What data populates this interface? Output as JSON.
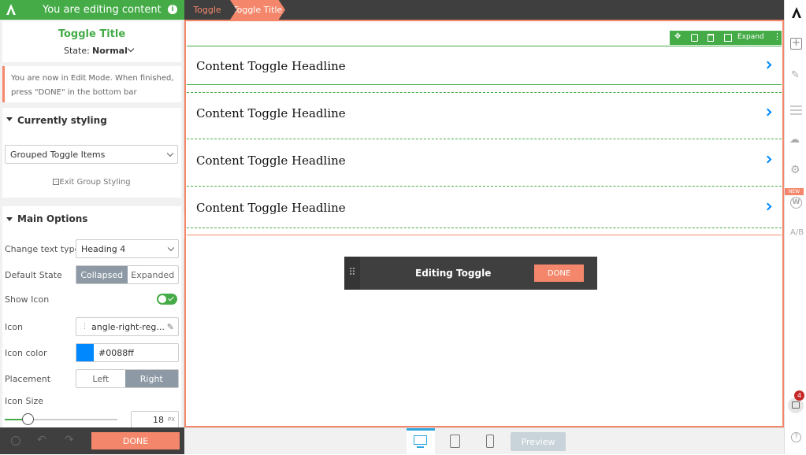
{
  "topbar": {
    "editing_title": "You are editing content",
    "breadcrumb": [
      "Toggle",
      "Toggle Title"
    ]
  },
  "panel": {
    "element_title": "Toggle Title",
    "state_label": "State:",
    "state_value": "Normal",
    "notice": "You are now in Edit Mode. When finished, press \"DONE\" in the bottom bar",
    "currently_styling_heading": "Currently styling",
    "styling_select": "Grouped Toggle Items",
    "exit_group": "Exit Group Styling",
    "main_options_heading": "Main Options",
    "change_text_type_label": "Change text type",
    "change_text_type_value": "Heading 4",
    "default_state_label": "Default State",
    "default_state_options": [
      "Collapsed",
      "Expanded"
    ],
    "show_icon_label": "Show Icon",
    "icon_label": "Icon",
    "icon_value": "angle-right-reg...",
    "icon_color_label": "Icon color",
    "icon_color_value": "#0088ff",
    "placement_label": "Placement",
    "placement_options": [
      "Left",
      "Right"
    ],
    "icon_size_label": "Icon Size",
    "icon_size_value": "18",
    "icon_size_unit": "PX",
    "icon_size_fraction": 0.2,
    "done_label": "DONE"
  },
  "canvas": {
    "toolbar_expand": "Expand",
    "headlines": [
      "Content Toggle Headline",
      "Content Toggle Headline",
      "Content Toggle Headline",
      "Content Toggle Headline"
    ],
    "editing_bar_title": "Editing Toggle",
    "editing_bar_done": "DONE"
  },
  "bottombar": {
    "preview_label": "Preview"
  },
  "rightbar": {
    "new_badge": "NEW",
    "notification_count": "4"
  },
  "colors": {
    "brand_green": "#44ab47",
    "accent_orange": "#f4876b",
    "icon_blue": "#0088ff",
    "dark": "#3f3f3f"
  }
}
